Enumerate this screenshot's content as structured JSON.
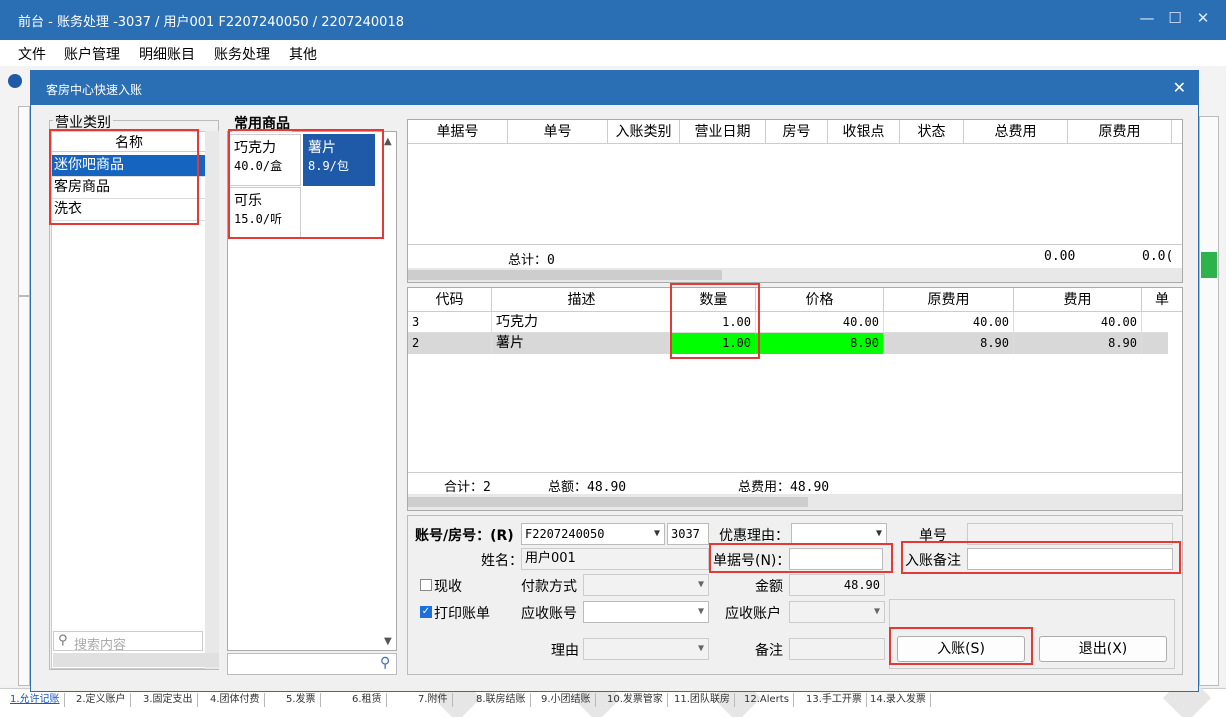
{
  "window": {
    "title": "前台 - 账务处理 -3037 / 用户001 F2207240050 / 2207240018",
    "min": "—",
    "max": "☐",
    "close": "✕"
  },
  "menu": [
    "文件",
    "账户管理",
    "明细账目",
    "账务处理",
    "其他"
  ],
  "dialog": {
    "title": "客房中心快速入账",
    "close": "✕"
  },
  "category": {
    "group_label": "营业类别",
    "header": "名称",
    "items": [
      "迷你吧商品",
      "客房商品",
      "洗衣"
    ],
    "search_placeholder": "搜索内容"
  },
  "products": {
    "group_label": "常用商品",
    "tiles": [
      {
        "name": "巧克力",
        "price": "40.0/盒"
      },
      {
        "name": "薯片",
        "price": "8.9/包"
      },
      {
        "name": "可乐",
        "price": "15.0/听"
      }
    ]
  },
  "bill_grid": {
    "headers": [
      "单据号",
      "单号",
      "入账类别",
      "营业日期",
      "房号",
      "收银点",
      "状态",
      "总费用",
      "原费用"
    ],
    "total_label": "总计：0",
    "total_a": "0.00",
    "total_b": "0.0("
  },
  "item_grid": {
    "headers": [
      "代码",
      "描述",
      "数量",
      "价格",
      "原费用",
      "费用",
      "单"
    ],
    "rows": [
      {
        "code": "3",
        "desc": "巧克力",
        "qty": "1.00",
        "price": "40.00",
        "orig": "40.00",
        "fee": "40.00"
      },
      {
        "code": "2",
        "desc": "薯片",
        "qty": "1.00",
        "price": "8.90",
        "orig": "8.90",
        "fee": "8.90"
      }
    ],
    "sum_count": "合计：2",
    "sum_amount": "总额：48.90",
    "sum_fee": "总费用：48.90"
  },
  "form": {
    "account_label": "账号/房号：(R)",
    "account_value": "F2207240050",
    "room_value": "3037",
    "discount_label": "优惠理由：",
    "bill_no_label": "单号",
    "name_label": "姓名：",
    "name_value": "用户001",
    "doc_no_label": "单据号(N)：",
    "remark_label": "入账备注",
    "cash_label": "现收",
    "pay_method_label": "付款方式",
    "amount_label": "金额",
    "amount_value": "48.90",
    "print_label": "打印账单",
    "recv_no_label": "应收账号",
    "recv_acct_label": "应收账户",
    "reason_label": "理由",
    "note_label": "备注",
    "post_button": "入账(S)",
    "exit_button": "退出(X)"
  },
  "bottom_tabs": [
    "1.允许记账",
    "2.定义账户",
    "3.固定支出",
    "4.团体付费",
    "5.发票",
    "6.租赁",
    "7.附件",
    "8.联房结账",
    "9.小团结账",
    "10.发票管家",
    "11.团队联房",
    "12.Alerts",
    "13.手工开票",
    "14.录入发票"
  ],
  "colors": {
    "accent": "#2a6fb4",
    "selection": "#1565c0",
    "highlight": "#00ff00",
    "annotation": "#e53935"
  }
}
